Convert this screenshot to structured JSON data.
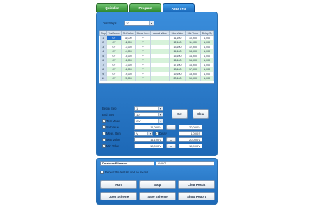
{
  "tabs": [
    "Quicklist",
    "Program",
    "Auto Test"
  ],
  "test_steps": {
    "label": "Test Steps",
    "value": "10"
  },
  "table": {
    "headers": [
      "Step",
      "Test Mode",
      "Set Value",
      "Meas. Item",
      "Actual Value",
      "Max Value",
      "Min Value",
      "Delay(S)"
    ],
    "rows": [
      [
        "1",
        "CV",
        "11,000",
        "V",
        "",
        "11,100",
        "10,900",
        "1,000"
      ],
      [
        "2",
        "CV",
        "12,000",
        "V",
        "",
        "12,100",
        "11,900",
        "1,000"
      ],
      [
        "3",
        "CV",
        "13,000",
        "V",
        "",
        "13,100",
        "12,900",
        "1,000"
      ],
      [
        "4",
        "CV",
        "14,000",
        "V",
        "",
        "14,100",
        "13,900",
        "1,000"
      ],
      [
        "5",
        "CV",
        "15,000",
        "V",
        "",
        "15,100",
        "14,900",
        "1,000"
      ],
      [
        "6",
        "CV",
        "16,000",
        "V",
        "",
        "16,100",
        "15,900",
        "1,000"
      ],
      [
        "7",
        "CV",
        "17,000",
        "V",
        "",
        "17,100",
        "16,900",
        "1,000"
      ],
      [
        "8",
        "CV",
        "18,000",
        "V",
        "",
        "18,100",
        "17,900",
        "1,000"
      ],
      [
        "9",
        "CV",
        "19,000",
        "V",
        "",
        "19,100",
        "18,900",
        "1,000"
      ],
      [
        "10",
        "CV",
        "20,000",
        "V",
        "",
        "20,100",
        "19,900",
        "1,000"
      ]
    ]
  },
  "form": {
    "begin_step": {
      "label": "Begin Step",
      "value": "1"
    },
    "end_step": {
      "label": "End Step",
      "value": "10"
    },
    "test_mode": {
      "label": "Test Mode",
      "value": "CV"
    },
    "set_value": {
      "label": "Set Value",
      "value": "11,000 V",
      "minus": "—",
      "right": "20,000 V"
    },
    "meas_item": {
      "label": "Meas. Item",
      "value": "V",
      "delay_label": "Delay",
      "delay_value": "1,000 S"
    },
    "max_value": {
      "label": "Max Value",
      "value": "11,100 V",
      "minus": "—",
      "right": "20,000 V"
    },
    "min_value": {
      "label": "Min Value",
      "value": "10,000 V",
      "minus": "—",
      "right": "19,900 V"
    },
    "set_button": "Set",
    "clear_button": "Clear"
  },
  "bottom": {
    "db_label": "Database Filename",
    "db_value": "GoNG",
    "repeat_label": "Repeat the test list and no record",
    "run": "Run",
    "stop": "Stop",
    "clear_result": "Clear Result",
    "open_scheme": "Open Scheme",
    "save_scheme": "Save Scheme",
    "show_report": "Show Report"
  }
}
